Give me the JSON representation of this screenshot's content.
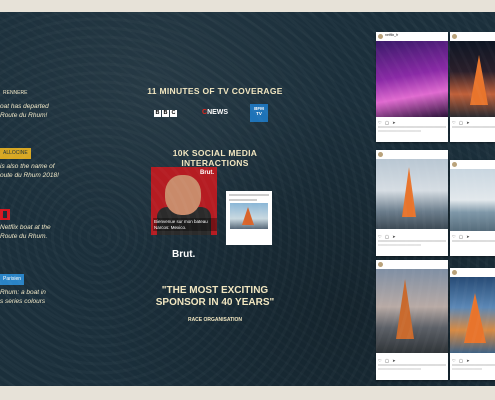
{
  "left_column": {
    "items": [
      {
        "tag": "RENNERE",
        "lines": [
          "oat has departed",
          "Route du Rhum!"
        ]
      },
      {
        "tag": "ALLOCINE",
        "lines": [
          "is also the name of",
          "oute du Rhum 2018!"
        ]
      },
      {
        "tag": "",
        "lines": [
          "Netflix boat at the",
          "Route du Rhum."
        ]
      },
      {
        "tag": "Parisien",
        "lines": [
          "Rhum: a boat in",
          "s series colours"
        ]
      }
    ]
  },
  "center": {
    "tv_heading": "11 MINUTES OF TV COVERAGE",
    "tv_logos": {
      "bbc": [
        "B",
        "B",
        "C"
      ],
      "cnews_c": "C",
      "cnews_rest": "NEWS",
      "bfm_top": "BFM",
      "bfm_bottom": "TV"
    },
    "social_heading": "10K SOCIAL MEDIA INTERACTIONS",
    "brut_caption": "Bienvenue sur mon bateau Narcos: Mexico.",
    "brut_tag": "Brut.",
    "brut_label": "Brut.",
    "quote_line1": "\"THE MOST EXCITING",
    "quote_line2": "SPONSOR IN 40 YEARS\"",
    "quote_source": "RACE ORGANISATION"
  },
  "instagram_posts": [
    {
      "user": "netflix_fr",
      "image": "purple-stage"
    },
    {
      "user": "",
      "image": "night-boat"
    },
    {
      "user": "",
      "image": "harbor"
    },
    {
      "user": "",
      "image": "sea"
    },
    {
      "user": "",
      "image": "dusk-boat"
    },
    {
      "user": "",
      "image": "sail"
    }
  ],
  "post_actions": "♡ ◯ ➤"
}
